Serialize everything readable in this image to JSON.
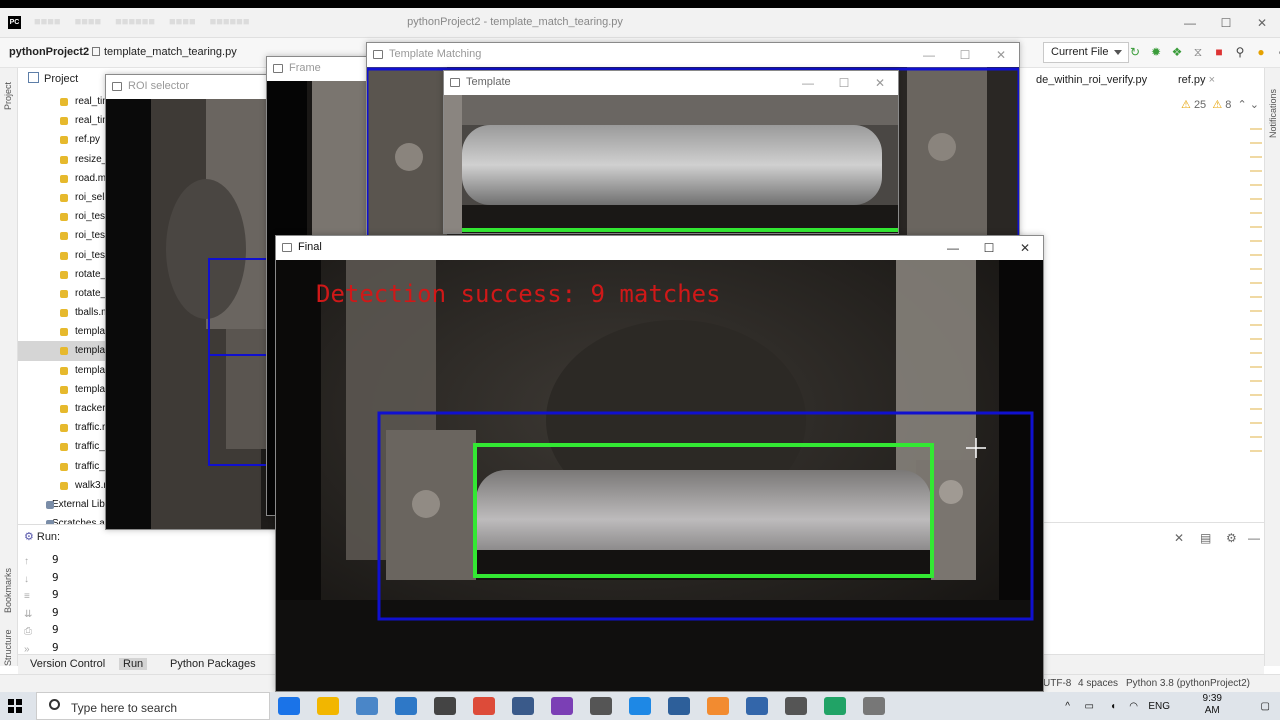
{
  "ide": {
    "title": "pythonProject2 - template_match_tearing.py",
    "project_name": "pythonProject2",
    "file_crumb": "template_match_tearing.py",
    "run_config": "Current File",
    "left_strip_labels": [
      "Project",
      "Bookmarks",
      "Structure"
    ],
    "right_strip_label": "Notifications",
    "project_header": "Project",
    "tree_items": [
      "real_tim",
      "real_tim",
      "ref.py",
      "resize_t",
      "road.m",
      "roi_sele",
      "roi_test",
      "roi_test",
      "roi_test",
      "rotate_l",
      "rotate_l",
      "tballs.m",
      "templat",
      "templat",
      "templat",
      "templat",
      "tracker_",
      "traffic.r",
      "traffic_c",
      "traffic_c",
      "walk3.r"
    ],
    "external_libs": "External Lib",
    "scratches": "Scratches a",
    "editor_tabs": [
      "de_within_roi_verify.py",
      "ref.py"
    ],
    "warnings": {
      "warn_count": "25",
      "weak_count": "8"
    },
    "run_header": "Run:",
    "run_output": [
      "9",
      "9",
      "9",
      "9",
      "9",
      "9"
    ],
    "bottom_tabs": {
      "version_control": "Version Control",
      "run": "Run",
      "python_packages": "Python Packages"
    },
    "status": {
      "encoding": "UTF-8",
      "indent": "4 spaces",
      "interpreter": "Python 3.8 (pythonProject2)"
    }
  },
  "windows": {
    "roi_selector": {
      "title": "ROI selector"
    },
    "frame": {
      "title": "Frame"
    },
    "template_matching": {
      "title": "Template Matching"
    },
    "template": {
      "title": "Template"
    },
    "final": {
      "title": "Final",
      "overlay_text": "Detection success: 9 matches"
    }
  },
  "window_controls": {
    "minimize": "—",
    "maximize": "☐",
    "close": "✕"
  },
  "taskbar": {
    "search_placeholder": "Type here to search",
    "language": "ENG",
    "time": "9:39 AM",
    "date": "",
    "app_colors": [
      "#1a73e8",
      "#f2b600",
      "#4a86c8",
      "#2e78c7",
      "#444444",
      "#dd4b39",
      "#3a5a8a",
      "#7b3fb5",
      "#555555",
      "#1e88e5",
      "#2d5f9a",
      "#f28b30",
      "#3366aa",
      "#555555",
      "#21a366",
      "#777777"
    ]
  },
  "colors": {
    "detect_green": "#33e833",
    "roi_blue": "#1010d0",
    "overlay_red": "#d01818"
  }
}
